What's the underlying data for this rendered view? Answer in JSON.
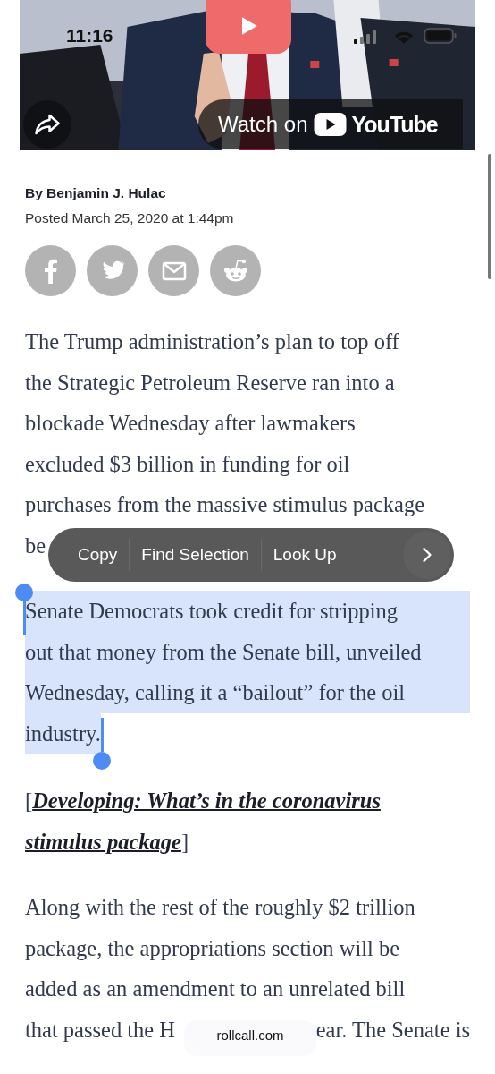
{
  "status_bar": {
    "time": "11:16"
  },
  "video": {
    "kind": "picture",
    "watch_label": "Watch on",
    "brand": "YouTube"
  },
  "byline": {
    "author": "By Benjamin J. Hulac",
    "posted": "Posted March 25, 2020 at 1:44pm"
  },
  "share_buttons": [
    {
      "kind": "facebook"
    },
    {
      "kind": "twitter"
    },
    {
      "kind": "email"
    },
    {
      "kind": "reddit"
    }
  ],
  "paragraphs": [
    {
      "kind": "text",
      "selected": false,
      "lines": [
        "The Trump administration’s plan to top off",
        "the Strategic Petroleum Reserve ran into a",
        "blockade Wednesday after lawmakers",
        "excluded $3 billion in funding for oil",
        "purchases from the massive stimulus package"
      ],
      "covered_line": "be"
    },
    {
      "kind": "text",
      "selected": true,
      "lines": [
        "Senate Democrats took credit for stripping",
        "out that money from the Senate bill, unveiled",
        "Wednesday, calling it a “bailout” for the oil",
        "industry."
      ]
    },
    {
      "kind": "link",
      "before": "[",
      "lines": [
        "Developing: What’s in the coronavirus",
        "stimulus package"
      ],
      "after": "]"
    },
    {
      "kind": "text",
      "selected": false,
      "lines": [
        "Along with the rest of the roughly $2 trillion",
        "package, the appropriations section will be",
        "added as an amendment to an unrelated bill"
      ],
      "tail_start": "that passed the H",
      "tail": "ear. The Senate is"
    }
  ],
  "context_menu": {
    "items": [
      {
        "label": "Copy"
      },
      {
        "label": "Find Selection"
      },
      {
        "label": "Look Up"
      }
    ]
  },
  "address_pill": {
    "domain": "rollcall.com"
  }
}
